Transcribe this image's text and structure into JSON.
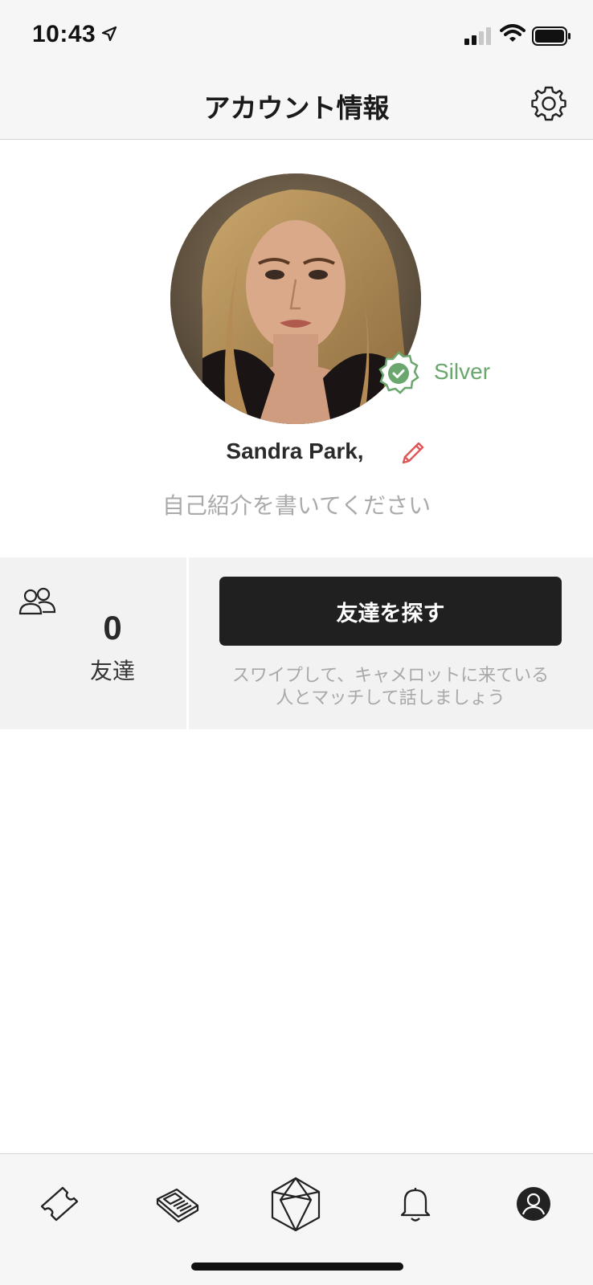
{
  "status_bar": {
    "time": "10:43"
  },
  "header": {
    "title": "アカウント情報"
  },
  "profile": {
    "name": "Sandra Park,",
    "rank": "Silver",
    "bio_placeholder": "自己紹介を書いてください"
  },
  "friends": {
    "count": "0",
    "label": "友達"
  },
  "actions": {
    "find_friends_label": "友達を探す",
    "hint_line1": "スワイプして、キャメロットに来ている",
    "hint_line2": "人とマッチして話しましょう"
  },
  "tabs": [
    {
      "name": "tickets",
      "icon": "ticket-icon"
    },
    {
      "name": "news",
      "icon": "newspaper-icon"
    },
    {
      "name": "home",
      "icon": "hexagon-logo-icon"
    },
    {
      "name": "notifications",
      "icon": "bell-icon"
    },
    {
      "name": "account",
      "icon": "account-icon",
      "active": true
    }
  ],
  "colors": {
    "accent_green": "#6aa66e",
    "edit_red": "#e05555",
    "button_dark": "#202020"
  }
}
